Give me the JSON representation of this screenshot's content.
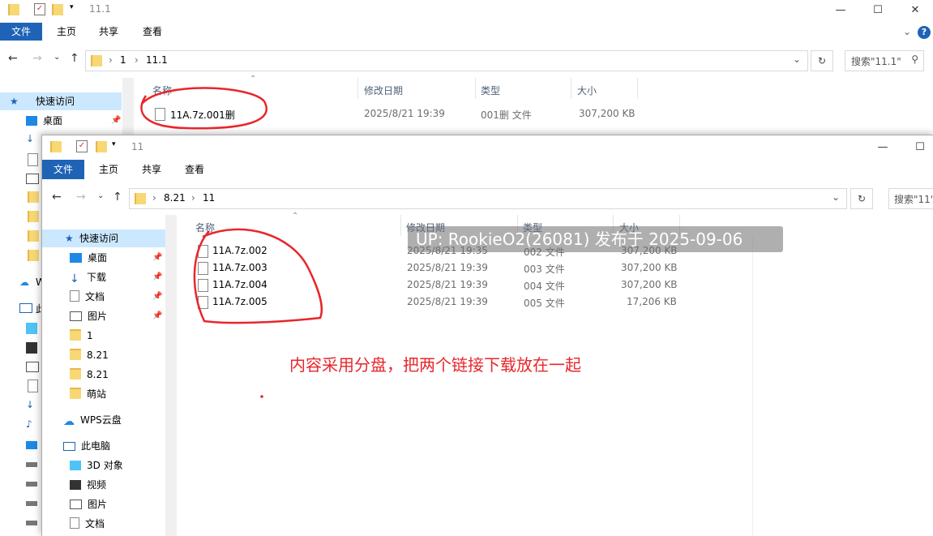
{
  "back_window": {
    "title": "11.1",
    "ribbon_tabs": [
      "文件",
      "主页",
      "共享",
      "查看"
    ],
    "breadcrumb": [
      "1",
      "11.1"
    ],
    "search_placeholder": "搜索\"11.1\"",
    "columns": {
      "name": "名称",
      "modified": "修改日期",
      "type": "类型",
      "size": "大小"
    },
    "files": [
      {
        "name": "11A.7z.001删",
        "modified": "2025/8/21 19:39",
        "type": "001删 文件",
        "size": "307,200 KB"
      }
    ],
    "nav": {
      "quick_access": "快速访问",
      "desktop": "桌面",
      "wps_partial": "W",
      "pc_partial": "此"
    }
  },
  "front_window": {
    "title": "11",
    "ribbon_tabs": [
      "文件",
      "主页",
      "共享",
      "查看"
    ],
    "breadcrumb": [
      "8.21",
      "11"
    ],
    "search_placeholder": "搜索\"11\"",
    "columns": {
      "name": "名称",
      "modified": "修改日期",
      "type": "类型",
      "size": "大小"
    },
    "files": [
      {
        "name": "11A.7z.002",
        "modified": "2025/8/21 19:35",
        "type": "002 文件",
        "size": "307,200 KB"
      },
      {
        "name": "11A.7z.003",
        "modified": "2025/8/21 19:39",
        "type": "003 文件",
        "size": "307,200 KB"
      },
      {
        "name": "11A.7z.004",
        "modified": "2025/8/21 19:39",
        "type": "004 文件",
        "size": "307,200 KB"
      },
      {
        "name": "11A.7z.005",
        "modified": "2025/8/21 19:39",
        "type": "005 文件",
        "size": "17,206 KB"
      }
    ],
    "nav": {
      "quick_access": "快速访问",
      "items": [
        "桌面",
        "下载",
        "文档",
        "图片",
        "1",
        "8.21",
        "8.21",
        "萌站"
      ],
      "wps": "WPS云盘",
      "pc": "此电脑",
      "pc_items": [
        "3D 对象",
        "视频",
        "图片",
        "文档"
      ]
    }
  },
  "overlay": {
    "watermark": "UP: RookieO2(26081) 发布于 2025-09-06",
    "note": "内容采用分盘，把两个链接下载放在一起"
  },
  "colors": {
    "accent": "#1e63b6",
    "annotation_red": "#e8262b",
    "nav_selected": "#cce8ff"
  }
}
